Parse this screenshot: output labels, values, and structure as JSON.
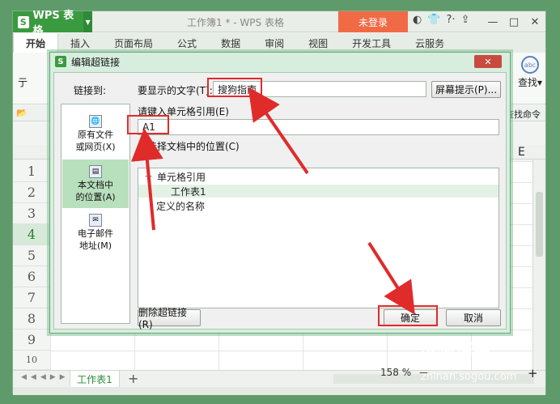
{
  "app": {
    "name": "WPS 表格",
    "doc_title": "工作簿1 * - WPS 表格",
    "login": "未登录",
    "title_icons": [
      "◐",
      "👕",
      "?·",
      "⇪"
    ],
    "window_controls": [
      "—",
      "□",
      "✕"
    ]
  },
  "ribbon": {
    "tabs": [
      "开始",
      "插入",
      "页面布局",
      "公式",
      "数据",
      "审阅",
      "视图",
      "开发工具",
      "云服务"
    ],
    "active_tab": "开始",
    "sort_label": "查找▾",
    "find_command": "查找命令",
    "left_fragment": "亍"
  },
  "sheet": {
    "column_e": "E",
    "rows": [
      "1",
      "2",
      "3",
      "4",
      "5",
      "6",
      "7",
      "8",
      "9",
      "10"
    ],
    "selected_row": "4",
    "tab": "工作表1",
    "add_tab": "+",
    "zoom": "158 %",
    "zoom_minus": "—",
    "zoom_plus": "+"
  },
  "dialog": {
    "title": "编辑超链接",
    "close": "✕",
    "link_to_label": "链接到:",
    "display_text_label": "要显示的文字(T):",
    "display_text_value": "搜狗指南",
    "screen_tip_button": "屏幕提示(P)...",
    "cell_ref_label": "请键入单元格引用(E)",
    "cell_ref_value": "A1",
    "location_label": "请选择文档中的位置(C)",
    "link_items": [
      {
        "label1": "原有文件",
        "label2": "或网页(X)"
      },
      {
        "label1": "本文档中",
        "label2": "的位置(A)"
      },
      {
        "label1": "电子邮件",
        "label2": "地址(M)"
      }
    ],
    "tree": {
      "cell_ref_node": "单元格引用",
      "sheet_node": "工作表1",
      "defined_names_node": "定义的名称",
      "expander": "—"
    },
    "remove_link_button": "删除超链接(R)",
    "ok_button": "确定",
    "cancel_button": "取消"
  },
  "watermark": {
    "text": "搜狗指南",
    "url": "zhinan.sogou.com"
  },
  "colors": {
    "brand_green": "#3a9a3f",
    "login_orange": "#f06b45",
    "annotation_red": "#e02b2b",
    "selected_link_bg": "#b9e0bd"
  }
}
